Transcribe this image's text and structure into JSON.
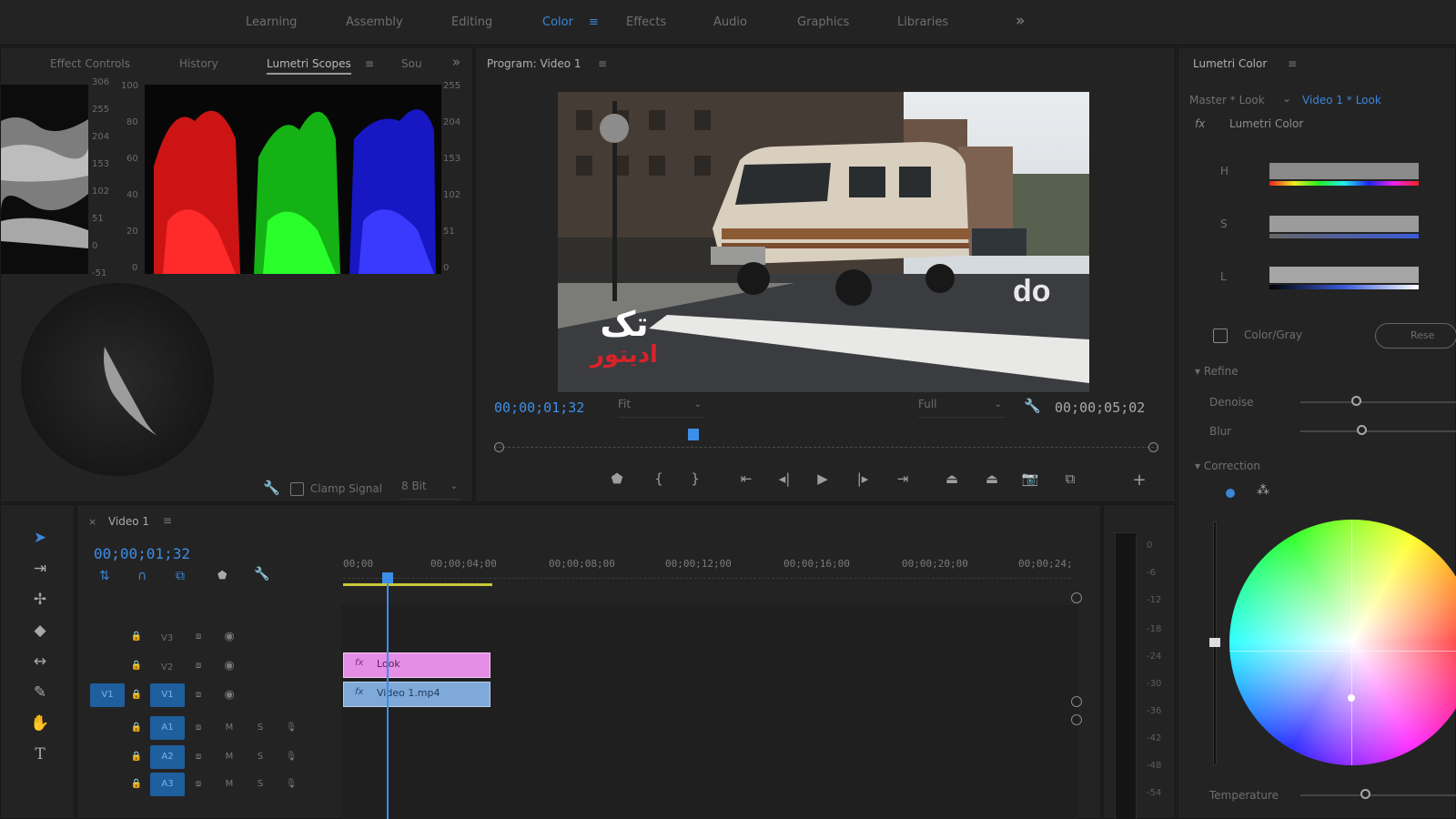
{
  "workspaces": {
    "items": [
      "Learning",
      "Assembly",
      "Editing",
      "Color",
      "Effects",
      "Audio",
      "Graphics",
      "Libraries"
    ],
    "active": "Color",
    "menu_icon": "hamburger-icon",
    "more_icon": "double-chevron-right-icon"
  },
  "scopes_panel": {
    "tabs": [
      "Effect Controls",
      "History",
      "Lumetri Scopes",
      "Sou"
    ],
    "active_tab": "Lumetri Scopes",
    "waveform_scale": [
      "306",
      "255",
      "204",
      "153",
      "102",
      "51",
      "0",
      "-51"
    ],
    "parade_scale_left": [
      "100",
      "80",
      "60",
      "40",
      "20",
      "0"
    ],
    "parade_scale_right": [
      "255",
      "204",
      "153",
      "102",
      "51",
      "0"
    ],
    "clamp_signal_label": "Clamp Signal",
    "bit_depth": "8 Bit"
  },
  "program_monitor": {
    "title": "Program: Video 1",
    "current_timecode": "00;00;01;32",
    "duration_timecode": "00;00;05;02",
    "zoom_value": "Fit",
    "resolution_value": "Full",
    "playhead_fraction": 0.3,
    "watermark_line1": "تک",
    "watermark_line2": "ادیتور"
  },
  "lumetri_panel": {
    "title": "Lumetri Color",
    "master_look": "Master * Look",
    "clip_look": "Video 1 * Look",
    "effect_name": "Lumetri Color",
    "fx_label": "fx",
    "hsl_labels": [
      "H",
      "S",
      "L"
    ],
    "color_gray_label": "Color/Gray",
    "reset_label": "Rese",
    "refine_label": "Refine",
    "denoise_label": "Denoise",
    "blur_label": "Blur",
    "correction_label": "Correction",
    "temperature_label": "Temperature"
  },
  "timeline": {
    "sequence_name": "Video 1",
    "timecode": "00;00;01;32",
    "ruler": [
      "00;00",
      "00;00;04;00",
      "00;00;08;00",
      "00;00;12;00",
      "00;00;16;00",
      "00;00;20;00",
      "00;00;24;"
    ],
    "tracks": [
      {
        "id": "V3",
        "type": "video"
      },
      {
        "id": "V2",
        "type": "video"
      },
      {
        "id": "V1",
        "type": "video",
        "source_patch": "V1"
      },
      {
        "id": "A1",
        "type": "audio"
      },
      {
        "id": "A2",
        "type": "audio"
      },
      {
        "id": "A3",
        "type": "audio"
      }
    ],
    "audio_toggle_mute": "M",
    "audio_toggle_solo": "S",
    "clips": [
      {
        "track": "V2",
        "name": "Look",
        "color": "#e58ee6",
        "fx_icon": "fx"
      },
      {
        "track": "V1",
        "name": "Video 1.mp4",
        "color": "#7fa9d8",
        "fx_icon": "fx"
      }
    ],
    "meter_scale": [
      "0",
      "-6",
      "-12",
      "-18",
      "-24",
      "-30",
      "-36",
      "-42",
      "-48",
      "-54"
    ]
  },
  "colors": {
    "accent": "#3c86d8",
    "panel_bg": "#232323",
    "app_bg": "#1d1d1d",
    "look_clip": "#e58ee6",
    "video_clip": "#7fa9d8",
    "watermark_red": "#d8232a"
  }
}
